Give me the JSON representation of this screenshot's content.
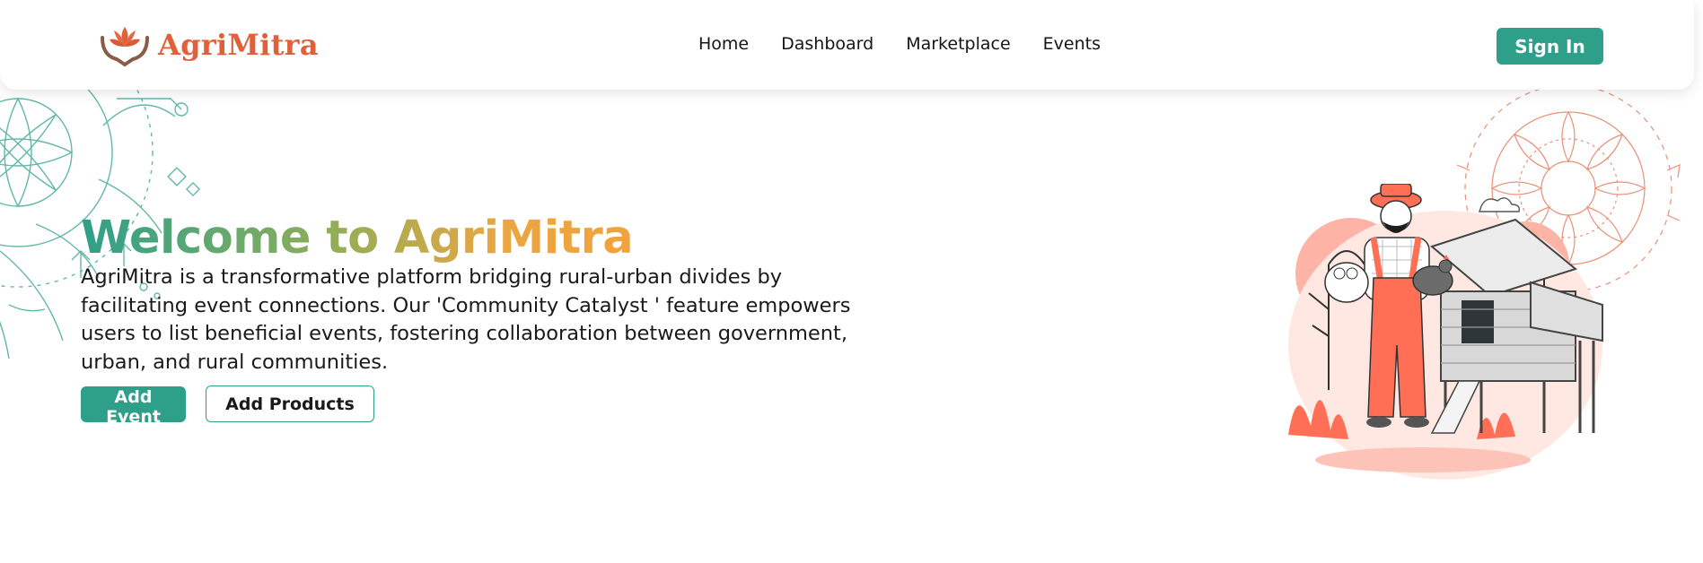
{
  "brand": {
    "name": "AgriMitra",
    "logo_icon": "hands-lotus-icon",
    "color": "#e0603c"
  },
  "nav": {
    "links": [
      {
        "label": "Home"
      },
      {
        "label": "Dashboard"
      },
      {
        "label": "Marketplace"
      },
      {
        "label": "Events"
      }
    ],
    "signin_label": "Sign In"
  },
  "hero": {
    "title": "Welcome to AgriMitra",
    "description": "AgriMitra is a transformative platform bridging rural-urban divides by facilitating event connections. Our 'Community Catalyst ' feature empowers users to list beneficial events, fostering collaboration between government, urban, and rural communities.",
    "add_event_label": "Add Event",
    "add_products_label": "Add Products",
    "illustration_icon": "farmer-with-chicken-coop-illustration"
  },
  "colors": {
    "accent": "#2ea08a",
    "brand": "#e0603c",
    "gradient_end": "#f2a23c",
    "illustration_coral": "#ff6f55"
  }
}
